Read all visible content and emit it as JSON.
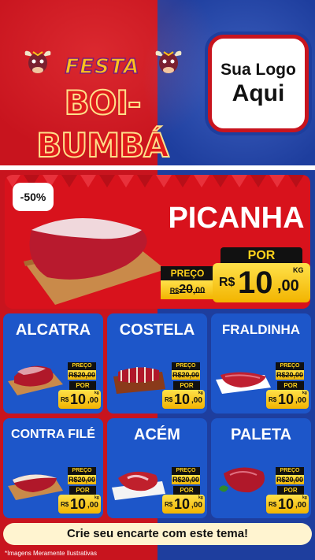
{
  "header": {
    "festa": "FESTA",
    "boi_bumba": "BOI-BUMBÁ",
    "logo_line1": "Sua Logo",
    "logo_line2": "Aqui"
  },
  "hero": {
    "discount": "-50%",
    "name": "PICANHA",
    "preco_label": "PREÇO",
    "old_currency": "R$",
    "old_int": "20",
    "old_dec": ",00",
    "por_label": "POR",
    "currency": "R$",
    "price_int": "10",
    "price_dec": ",00",
    "unit": "KG"
  },
  "cards": [
    {
      "name": "ALCATRA",
      "preco_label": "PREÇO",
      "old": "R$20,00",
      "por_label": "POR",
      "currency": "R$",
      "price_int": "10",
      "price_dec": ",00",
      "unit": "kg"
    },
    {
      "name": "COSTELA",
      "preco_label": "PREÇO",
      "old": "R$20,00",
      "por_label": "POR",
      "currency": "R$",
      "price_int": "10",
      "price_dec": ",00",
      "unit": "kg"
    },
    {
      "name": "FRALDINHA",
      "preco_label": "PREÇO",
      "old": "R$20,00",
      "por_label": "POR",
      "currency": "R$",
      "price_int": "10",
      "price_dec": ",00",
      "unit": "kg"
    },
    {
      "name": "CONTRA FILÉ",
      "preco_label": "PREÇO",
      "old": "R$20,00",
      "por_label": "POR",
      "currency": "R$",
      "price_int": "10",
      "price_dec": ",00",
      "unit": "kg"
    },
    {
      "name": "ACÉM",
      "preco_label": "PREÇO",
      "old": "R$20,00",
      "por_label": "POR",
      "currency": "R$",
      "price_int": "10",
      "price_dec": ",00",
      "unit": "kg"
    },
    {
      "name": "PALETA",
      "preco_label": "PREÇO",
      "old": "R$20,00",
      "por_label": "POR",
      "currency": "R$",
      "price_int": "10",
      "price_dec": ",00",
      "unit": "kg"
    }
  ],
  "footer": {
    "cta": "Crie seu encarte com este tema!",
    "disclaimer": "*Imagens Meramente Ilustrativas"
  },
  "colors": {
    "red": "#c8141e",
    "blue": "#1e3e9e",
    "card_blue": "#1d56c9",
    "price_yellow": "#ffd21c"
  }
}
